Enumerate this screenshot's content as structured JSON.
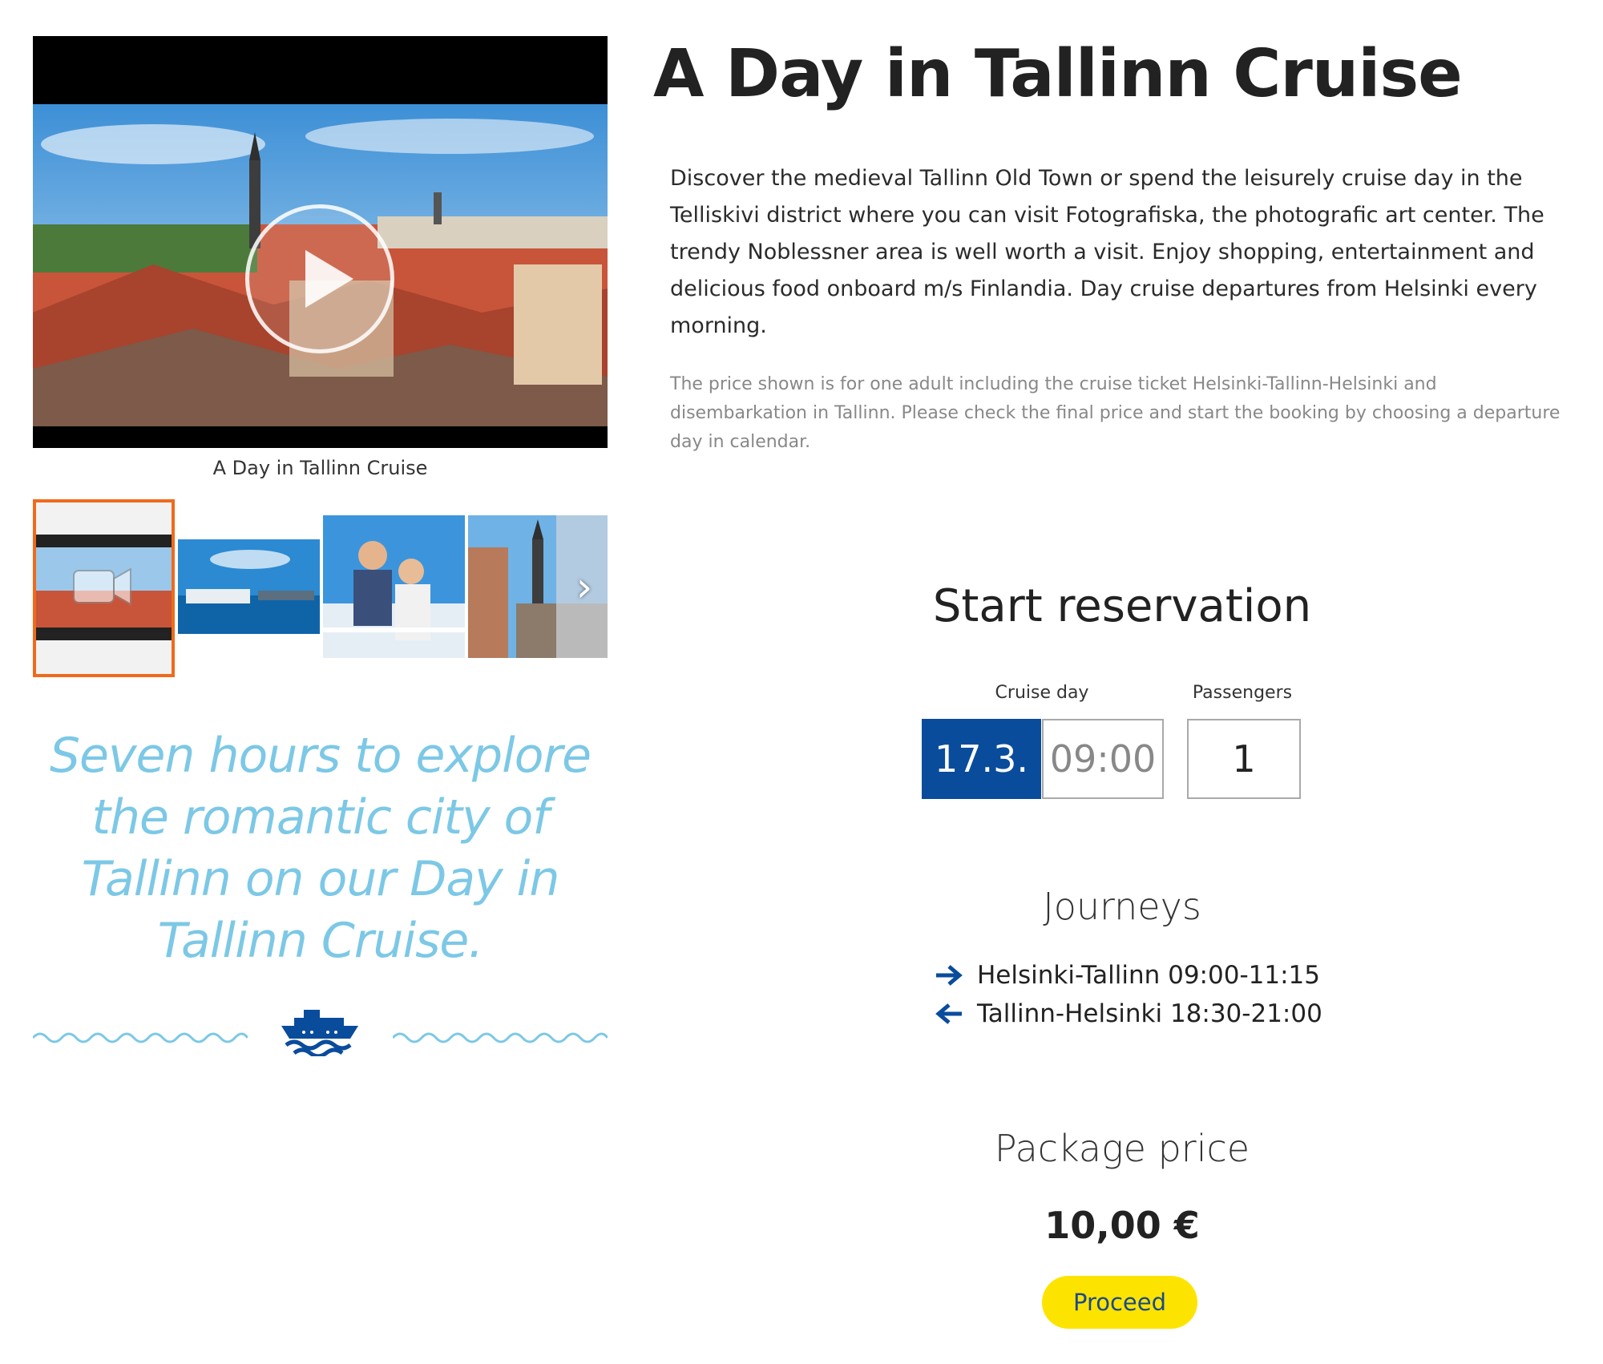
{
  "colors": {
    "brand_blue": "#0a4c9c",
    "accent_yellow": "#fde400",
    "tagline_blue": "#7cc8e6",
    "thumb_selected_border": "#ef6a1c"
  },
  "media": {
    "video_caption": "A Day in Tallinn Cruise",
    "play_icon": "play-icon",
    "thumbnails": [
      {
        "name": "video-thumbnail",
        "selected": true
      },
      {
        "name": "ship-harbor-photo",
        "selected": false
      },
      {
        "name": "couple-on-deck-photo",
        "selected": false
      },
      {
        "name": "old-town-square-photo",
        "selected": false
      }
    ],
    "next_icon": "chevron-right-icon"
  },
  "tagline": "Seven hours to explore the romantic city of Tallinn on our Day in Tallinn Cruise.",
  "product": {
    "title": "A Day in Tallinn Cruise",
    "description": "Discover the medieval Tallinn Old Town or spend the leisurely cruise day in the Telliskivi district where you can visit Fotografiska, the photografic art center. The trendy Noblessner area is well worth a visit.  Enjoy shopping, entertainment and delicious food onboard m/s Finlandia. Day cruise departures from Helsinki every morning.",
    "price_note": "The price shown is for one adult including the cruise ticket Helsinki-Tallinn-Helsinki and disembarkation in Tallinn. Please check the final price and start the booking by choosing a departure day in calendar."
  },
  "reservation": {
    "title": "Start reservation",
    "cruise_day_label": "Cruise day",
    "passengers_label": "Passengers",
    "date": "17.3.",
    "time": "09:00",
    "passengers": "1"
  },
  "journeys": {
    "title": "Journeys",
    "outbound": {
      "text": "Helsinki-Tallinn 09:00-11:15",
      "icon": "arrow-right-icon"
    },
    "return": {
      "text": "Tallinn-Helsinki 18:30-21:00",
      "icon": "arrow-left-icon"
    }
  },
  "price": {
    "title": "Package price",
    "value": "10,00 €",
    "proceed_label": "Proceed"
  }
}
